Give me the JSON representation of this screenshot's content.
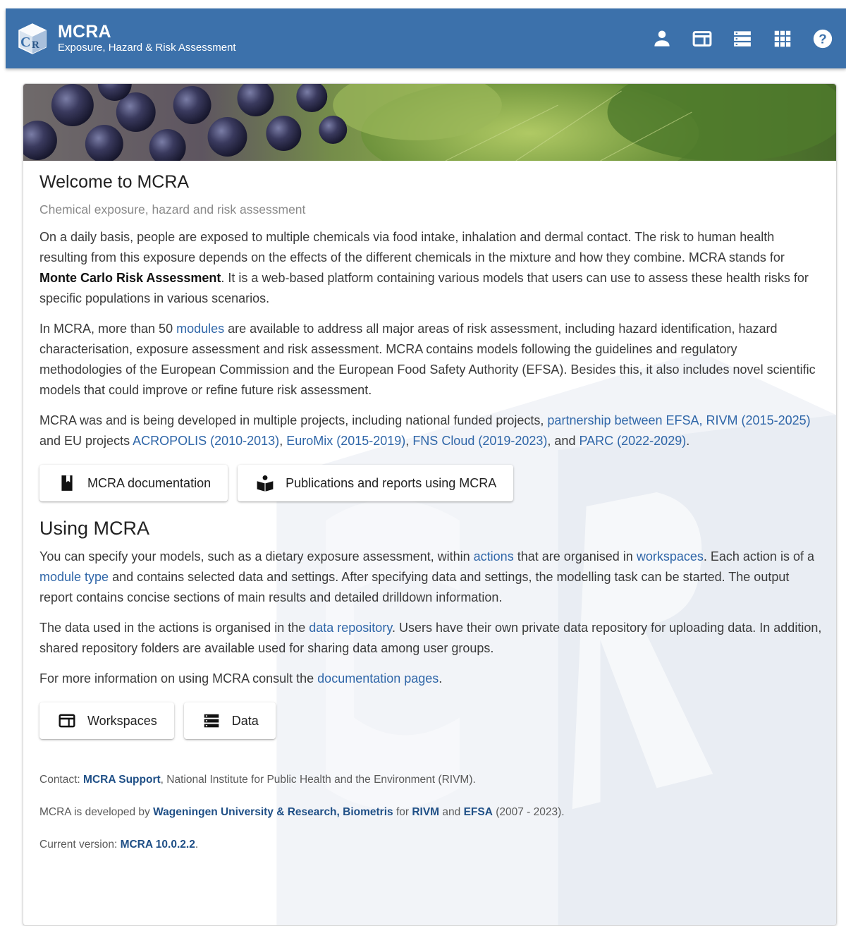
{
  "header": {
    "title": "MCRA",
    "subtitle": "Exposure, Hazard & Risk Assessment",
    "logo_letters": "MCRA",
    "bg_color": "#3c71ab"
  },
  "actions": [
    {
      "name": "account",
      "icon": "person-icon"
    },
    {
      "name": "workspaces",
      "icon": "workspaces-icon"
    },
    {
      "name": "data",
      "icon": "data-icon"
    },
    {
      "name": "apps",
      "icon": "apps-grid-icon"
    },
    {
      "name": "help",
      "icon": "help-icon"
    }
  ],
  "welcome": {
    "title": "Welcome to MCRA",
    "subtitle": "Chemical exposure, hazard and risk assessment",
    "p1": {
      "t1": "On a daily basis, people are exposed to multiple chemicals via food intake, inhalation and dermal contact. The risk to human health resulting from this exposure depends on the effects of the different chemicals in the mixture and how they combine. MCRA stands for ",
      "bold": "Monte Carlo Risk Assessment",
      "t2": ". It is a web-based platform containing various models that users can use to assess these health risks for specific populations in various scenarios."
    },
    "p2": {
      "t1": "In MCRA, more than 50 ",
      "link": "modules",
      "t2": " are available to address all major areas of risk assessment, including hazard identification, hazard characterisation, exposure assessment and risk assessment. MCRA contains models following the guidelines and regulatory methodologies of the European Commission and the European Food Safety Authority (EFSA). Besides this, it also includes novel scientific models that could improve or refine future risk assessment."
    },
    "p3": {
      "t1": "MCRA was and is being developed in multiple projects, including national funded projects, ",
      "link1": "partnership between EFSA, RIVM (2015-2025)",
      "t2": " and EU projects ",
      "link2": "ACROPOLIS (2010-2013)",
      "sep1": ", ",
      "link3": "EuroMix (2015-2019)",
      "sep2": ", ",
      "link4": "FNS Cloud (2019-2023)",
      "t3": ", and ",
      "link5": "PARC (2022-2029)",
      "t4": "."
    },
    "buttons": {
      "documentation": "MCRA documentation",
      "publications": "Publications and reports using MCRA"
    }
  },
  "using": {
    "title": "Using MCRA",
    "p1": {
      "t1": "You can specify your models, such as a dietary exposure assessment, within ",
      "link1": "actions",
      "t2": " that are organised in ",
      "link2": "workspaces",
      "t3": ". Each action is of a ",
      "link3": "module type",
      "t4": " and contains selected data and settings. After specifying data and settings, the modelling task can be started. The output report contains concise sections of main results and detailed drilldown information."
    },
    "p2": {
      "t1": "The data used in the actions is organised in the ",
      "link": "data repository",
      "t2": ". Users have their own private data repository for uploading data. In addition, shared repository folders are available used for sharing data among user groups."
    },
    "p3": {
      "t1": "For more information on using MCRA consult the ",
      "link": "documentation pages",
      "t2": "."
    },
    "buttons": {
      "workspaces": "Workspaces",
      "data": "Data"
    }
  },
  "footer": {
    "contact": {
      "t1": "Contact: ",
      "link": "MCRA Support",
      "t2": ", National Institute for Public Health and the Environment (RIVM)."
    },
    "developed": {
      "t1": "MCRA is developed by ",
      "link1": "Wageningen University & Research, Biometris",
      "t2": " for ",
      "link2": "RIVM",
      "t3": " and ",
      "link3": "EFSA",
      "t4": " (2007 - 2023)."
    },
    "version": {
      "t1": "Current version: ",
      "link": "MCRA 10.0.2.2",
      "t2": "."
    }
  },
  "colors": {
    "link": "#2f66a8",
    "footer_link": "#1f4f86",
    "subtitle": "#8a8a8a"
  }
}
